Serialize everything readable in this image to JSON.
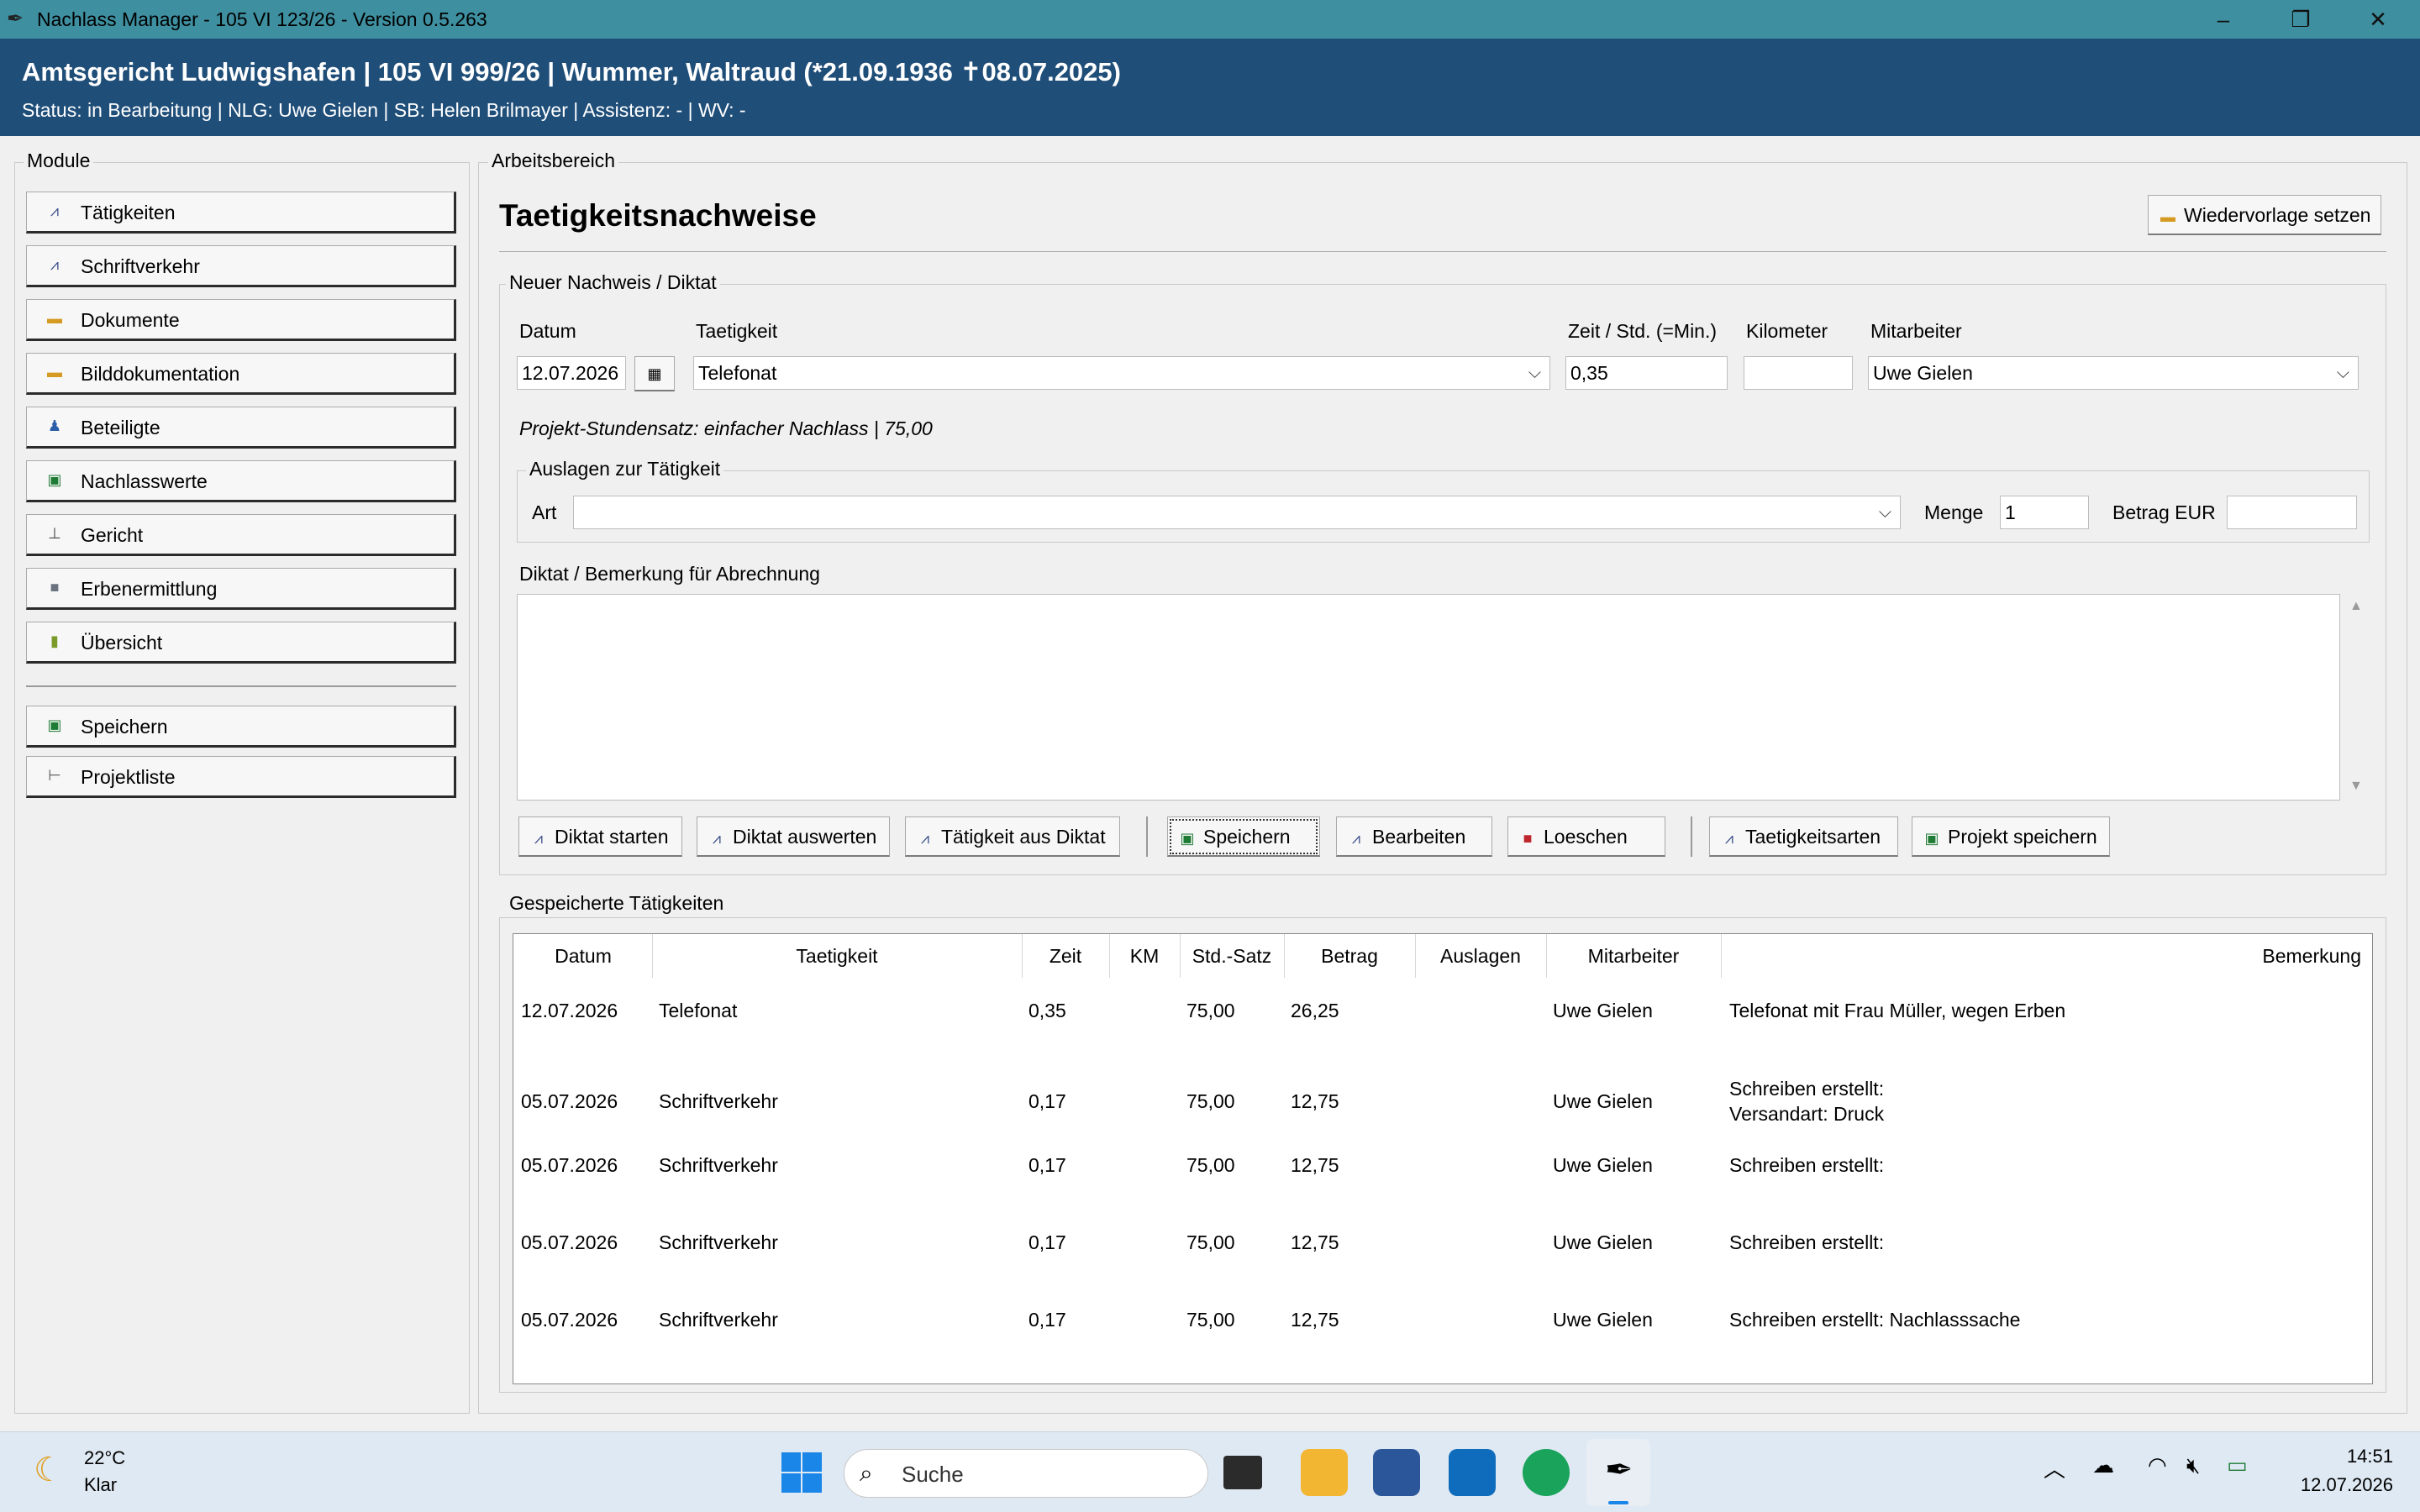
{
  "window": {
    "title": "Nachlass Manager - 105 VI 123/26 - Version 0.5.263",
    "app_icon": "quill-icon"
  },
  "header": {
    "title": "Amtsgericht Ludwigshafen | 105 VI 999/26 | Wummer, Waltraud (*21.09.1936 ✝08.07.2025)",
    "status": "Status: in Bearbeitung | NLG: Uwe Gielen | SB: Helen Brilmayer | Assistenz: - | WV: -"
  },
  "sidebar": {
    "group_label": "Module",
    "items": [
      {
        "label": "Tätigkeiten",
        "icon": "chart-icon"
      },
      {
        "label": "Schriftverkehr",
        "icon": "chart-icon"
      },
      {
        "label": "Dokumente",
        "icon": "folder-icon"
      },
      {
        "label": "Bilddokumentation",
        "icon": "folder-icon"
      },
      {
        "label": "Beteiligte",
        "icon": "people-icon"
      },
      {
        "label": "Nachlasswerte",
        "icon": "green-square-icon"
      },
      {
        "label": "Gericht",
        "icon": "court-icon"
      },
      {
        "label": "Erbenermittlung",
        "icon": "square-icon"
      },
      {
        "label": "Übersicht",
        "icon": "bars-icon"
      }
    ],
    "save_label": "Speichern",
    "projects_label": "Projektliste"
  },
  "workspace": {
    "group_label": "Arbeitsbereich",
    "title": "Taetigkeitsnachweise",
    "resubmit_label": "Wiedervorlage setzen"
  },
  "form": {
    "group_label": "Neuer Nachweis / Diktat",
    "date_label": "Datum",
    "date_value": "12.07.2026",
    "activity_label": "Taetigkeit",
    "activity_value": "Telefonat",
    "time_label": "Zeit / Std. (=Min.)",
    "time_value": "0,35",
    "km_label": "Kilometer",
    "km_value": "",
    "employee_label": "Mitarbeiter",
    "employee_value": "Uwe Gielen",
    "rate_text": "Projekt-Stundensatz: einfacher Nachlass | 75,00",
    "expenses": {
      "group_label": "Auslagen zur Tätigkeit",
      "type_label": "Art",
      "type_value": "",
      "qty_label": "Menge",
      "qty_value": "1",
      "amount_label": "Betrag EUR",
      "amount_value": ""
    },
    "dictation_label": "Diktat / Bemerkung für Abrechnung",
    "dictation_value": "",
    "buttons": {
      "start_dictation": "Diktat starten",
      "eval_dictation": "Diktat auswerten",
      "activity_from_dictation": "Tätigkeit aus Diktat",
      "save": "Speichern",
      "edit": "Bearbeiten",
      "delete": "Loeschen",
      "activity_types": "Taetigkeitsarten",
      "save_project": "Projekt speichern"
    }
  },
  "table": {
    "group_label": "Gespeicherte Tätigkeiten",
    "columns": [
      "Datum",
      "Taetigkeit",
      "Zeit",
      "KM",
      "Std.-Satz",
      "Betrag",
      "Auslagen",
      "Mitarbeiter",
      "Bemerkung"
    ],
    "rows": [
      {
        "date": "12.07.2026",
        "activity": "Telefonat",
        "time": "0,35",
        "km": "",
        "rate": "75,00",
        "amount": "26,25",
        "expenses": "",
        "employee": "Uwe Gielen",
        "note": "Telefonat mit Frau Müller, wegen Erben",
        "note2": ""
      },
      {
        "date": "05.07.2026",
        "activity": "Schriftverkehr",
        "time": "0,17",
        "km": "",
        "rate": "75,00",
        "amount": "12,75",
        "expenses": "",
        "employee": "Uwe Gielen",
        "note": "Schreiben erstellt:",
        "note2": "Versandart: Druck"
      },
      {
        "date": "05.07.2026",
        "activity": "Schriftverkehr",
        "time": "0,17",
        "km": "",
        "rate": "75,00",
        "amount": "12,75",
        "expenses": "",
        "employee": "Uwe Gielen",
        "note": "Schreiben erstellt:",
        "note2": ""
      },
      {
        "date": "05.07.2026",
        "activity": "Schriftverkehr",
        "time": "0,17",
        "km": "",
        "rate": "75,00",
        "amount": "12,75",
        "expenses": "",
        "employee": "Uwe Gielen",
        "note": "Schreiben erstellt:",
        "note2": ""
      },
      {
        "date": "05.07.2026",
        "activity": "Schriftverkehr",
        "time": "0,17",
        "km": "",
        "rate": "75,00",
        "amount": "12,75",
        "expenses": "",
        "employee": "Uwe Gielen",
        "note": "Schreiben erstellt: Nachlasssache",
        "note2": ""
      }
    ]
  },
  "taskbar": {
    "weather_temp": "22°C",
    "weather_text": "Klar",
    "search_placeholder": "Suche",
    "time": "14:51",
    "date": "12.07.2026"
  }
}
